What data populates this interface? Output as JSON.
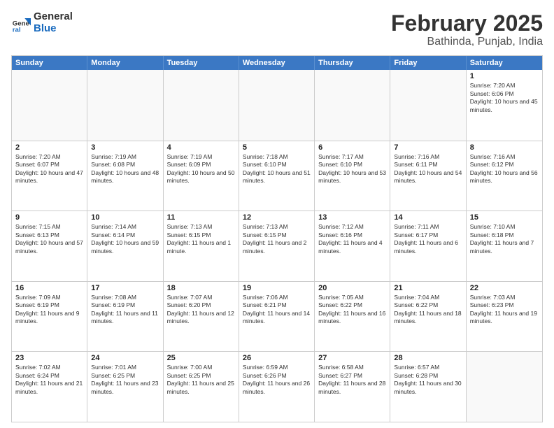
{
  "header": {
    "logo_general": "General",
    "logo_blue": "Blue",
    "title": "February 2025",
    "subtitle": "Bathinda, Punjab, India"
  },
  "days_of_week": [
    "Sunday",
    "Monday",
    "Tuesday",
    "Wednesday",
    "Thursday",
    "Friday",
    "Saturday"
  ],
  "weeks": [
    [
      {
        "day": "",
        "text": ""
      },
      {
        "day": "",
        "text": ""
      },
      {
        "day": "",
        "text": ""
      },
      {
        "day": "",
        "text": ""
      },
      {
        "day": "",
        "text": ""
      },
      {
        "day": "",
        "text": ""
      },
      {
        "day": "1",
        "text": "Sunrise: 7:20 AM\nSunset: 6:06 PM\nDaylight: 10 hours and 45 minutes."
      }
    ],
    [
      {
        "day": "2",
        "text": "Sunrise: 7:20 AM\nSunset: 6:07 PM\nDaylight: 10 hours and 47 minutes."
      },
      {
        "day": "3",
        "text": "Sunrise: 7:19 AM\nSunset: 6:08 PM\nDaylight: 10 hours and 48 minutes."
      },
      {
        "day": "4",
        "text": "Sunrise: 7:19 AM\nSunset: 6:09 PM\nDaylight: 10 hours and 50 minutes."
      },
      {
        "day": "5",
        "text": "Sunrise: 7:18 AM\nSunset: 6:10 PM\nDaylight: 10 hours and 51 minutes."
      },
      {
        "day": "6",
        "text": "Sunrise: 7:17 AM\nSunset: 6:10 PM\nDaylight: 10 hours and 53 minutes."
      },
      {
        "day": "7",
        "text": "Sunrise: 7:16 AM\nSunset: 6:11 PM\nDaylight: 10 hours and 54 minutes."
      },
      {
        "day": "8",
        "text": "Sunrise: 7:16 AM\nSunset: 6:12 PM\nDaylight: 10 hours and 56 minutes."
      }
    ],
    [
      {
        "day": "9",
        "text": "Sunrise: 7:15 AM\nSunset: 6:13 PM\nDaylight: 10 hours and 57 minutes."
      },
      {
        "day": "10",
        "text": "Sunrise: 7:14 AM\nSunset: 6:14 PM\nDaylight: 10 hours and 59 minutes."
      },
      {
        "day": "11",
        "text": "Sunrise: 7:13 AM\nSunset: 6:15 PM\nDaylight: 11 hours and 1 minute."
      },
      {
        "day": "12",
        "text": "Sunrise: 7:13 AM\nSunset: 6:15 PM\nDaylight: 11 hours and 2 minutes."
      },
      {
        "day": "13",
        "text": "Sunrise: 7:12 AM\nSunset: 6:16 PM\nDaylight: 11 hours and 4 minutes."
      },
      {
        "day": "14",
        "text": "Sunrise: 7:11 AM\nSunset: 6:17 PM\nDaylight: 11 hours and 6 minutes."
      },
      {
        "day": "15",
        "text": "Sunrise: 7:10 AM\nSunset: 6:18 PM\nDaylight: 11 hours and 7 minutes."
      }
    ],
    [
      {
        "day": "16",
        "text": "Sunrise: 7:09 AM\nSunset: 6:19 PM\nDaylight: 11 hours and 9 minutes."
      },
      {
        "day": "17",
        "text": "Sunrise: 7:08 AM\nSunset: 6:19 PM\nDaylight: 11 hours and 11 minutes."
      },
      {
        "day": "18",
        "text": "Sunrise: 7:07 AM\nSunset: 6:20 PM\nDaylight: 11 hours and 12 minutes."
      },
      {
        "day": "19",
        "text": "Sunrise: 7:06 AM\nSunset: 6:21 PM\nDaylight: 11 hours and 14 minutes."
      },
      {
        "day": "20",
        "text": "Sunrise: 7:05 AM\nSunset: 6:22 PM\nDaylight: 11 hours and 16 minutes."
      },
      {
        "day": "21",
        "text": "Sunrise: 7:04 AM\nSunset: 6:22 PM\nDaylight: 11 hours and 18 minutes."
      },
      {
        "day": "22",
        "text": "Sunrise: 7:03 AM\nSunset: 6:23 PM\nDaylight: 11 hours and 19 minutes."
      }
    ],
    [
      {
        "day": "23",
        "text": "Sunrise: 7:02 AM\nSunset: 6:24 PM\nDaylight: 11 hours and 21 minutes."
      },
      {
        "day": "24",
        "text": "Sunrise: 7:01 AM\nSunset: 6:25 PM\nDaylight: 11 hours and 23 minutes."
      },
      {
        "day": "25",
        "text": "Sunrise: 7:00 AM\nSunset: 6:25 PM\nDaylight: 11 hours and 25 minutes."
      },
      {
        "day": "26",
        "text": "Sunrise: 6:59 AM\nSunset: 6:26 PM\nDaylight: 11 hours and 26 minutes."
      },
      {
        "day": "27",
        "text": "Sunrise: 6:58 AM\nSunset: 6:27 PM\nDaylight: 11 hours and 28 minutes."
      },
      {
        "day": "28",
        "text": "Sunrise: 6:57 AM\nSunset: 6:28 PM\nDaylight: 11 hours and 30 minutes."
      },
      {
        "day": "",
        "text": ""
      }
    ]
  ]
}
